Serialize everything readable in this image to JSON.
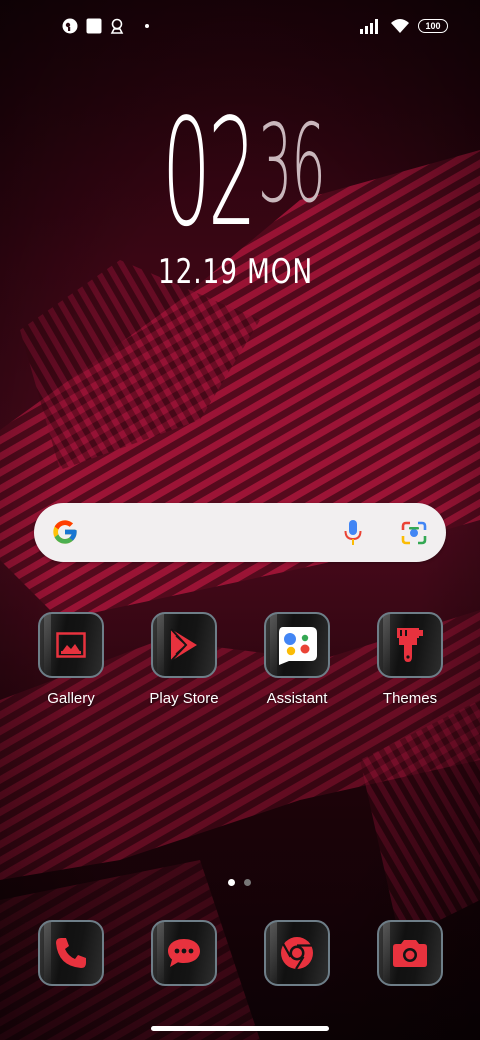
{
  "status_bar": {
    "left_icons": [
      "notification-app-icon",
      "notification-square-icon",
      "notification-location-icon",
      "more-dot-icon"
    ],
    "right_icons": [
      "signal-icon",
      "wifi-icon"
    ],
    "battery": "100"
  },
  "clock": {
    "hour": "02",
    "minute": "36",
    "date": "12.19 MON"
  },
  "search": {
    "left_icon": "google-g-icon",
    "mic_icon": "microphone-icon",
    "lens_icon": "google-lens-icon"
  },
  "apps": [
    {
      "label": "Gallery",
      "icon": "gallery-icon"
    },
    {
      "label": "Play Store",
      "icon": "play-store-icon"
    },
    {
      "label": "Assistant",
      "icon": "assistant-icon"
    },
    {
      "label": "Themes",
      "icon": "themes-brush-icon"
    }
  ],
  "pages": {
    "count": 2,
    "active": 1
  },
  "dock": [
    {
      "icon": "phone-icon"
    },
    {
      "icon": "messages-icon"
    },
    {
      "icon": "chrome-icon"
    },
    {
      "icon": "camera-icon"
    }
  ],
  "colors": {
    "accent": "#e8323e",
    "wallpaper": "#7a1030"
  }
}
